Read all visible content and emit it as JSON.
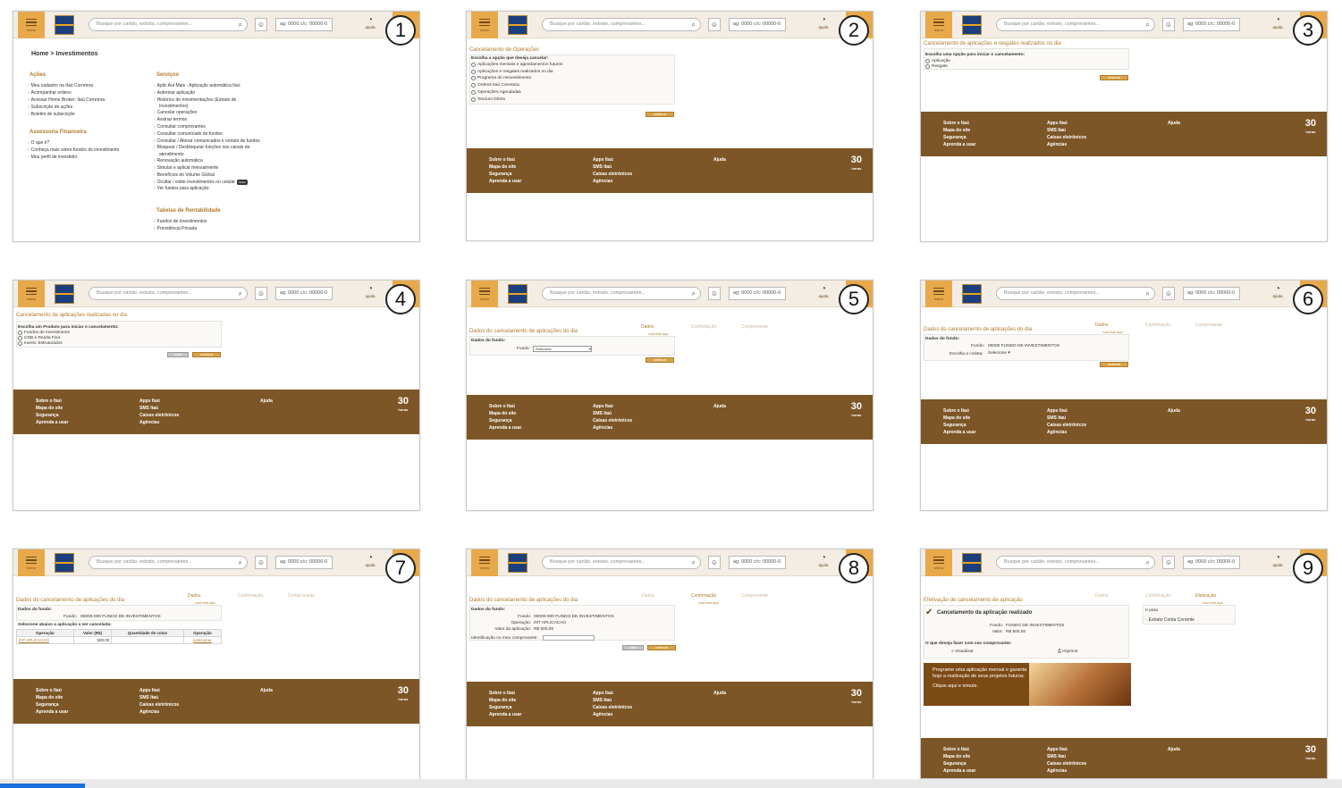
{
  "header": {
    "menu_label": "menu",
    "search_placeholder": "Busque por cartão, extrato, comprovantes...",
    "account": "ag: 0000 c/c: 00000-0",
    "help_label": "ajuda"
  },
  "footer": {
    "col1": [
      "Sobre o Itaú",
      "Mapa do site",
      "Segurança",
      "Aprenda a usar"
    ],
    "col2": [
      "Apps Itaú",
      "SMS Itaú",
      "Caixas eletrônicos",
      "Agências"
    ],
    "col3": [
      "Ajuda"
    ],
    "badge_num": "30",
    "badge_sub": "horas"
  },
  "panels": {
    "p1": {
      "number": "1",
      "breadcrumb": "Home > Investimentos",
      "acoes_title": "Ações",
      "acoes": [
        "Meu cadastro na Itaú Corretora",
        "Acompanhar ordens",
        "Acessar Home Broker: Itaú Corretora",
        "Subscrição de ações",
        "Boletim de subscrição"
      ],
      "assessoria_title": "Assessoria Financeira",
      "assessoria": [
        "O que é?",
        "Conheça mais sobre fundos de investimento",
        "Meu perfil de investidor"
      ],
      "servicos_title": "Serviços",
      "servicos": [
        "Aplic Aut Mais - Aplicação automática Itaú",
        "Autorizar aplicação",
        "Histórico de movimentações (Extrato de",
        "Investimentos)",
        "Cancelar operações",
        "Assinar termos",
        "Consultar comprovantes",
        "Consultar comunicado de fundos",
        "Consultar / Alterar comunicados e extrato de fundos",
        "Bloquear / Desbloquear funções nos canais de",
        "atendimento",
        "Renovação automática",
        "Simular e aplicar mensalmente",
        "Benefícios do Volume Global",
        "Ocultar / exibir investimentos no celular",
        "Ver fundos para aplicação"
      ],
      "novo_badge": "novo",
      "tabelas_title": "Tabelas de Rentabilidade",
      "tabelas": [
        "Fundos de Investimentos",
        "Previdência Privada"
      ]
    },
    "p2": {
      "number": "2",
      "title": "Cancelamento de Operações",
      "prompt": "Escolha a opção que deseja cancelar:",
      "options": [
        "Aplicações mensais e agendamentos futuros",
        "Aplicações e resgates realizados no dia",
        "Programa de reinvestimento",
        "Ordens Itaú Corretora",
        "Operações Agendadas",
        "Tesouro Direto"
      ],
      "continue": "continuar"
    },
    "p3": {
      "number": "3",
      "title": "Cancelamento de aplicações e resgates realizados no dia",
      "prompt": "Escolha uma opção para iniciar o cancelamento:",
      "options": [
        "Aplicação",
        "Resgate"
      ],
      "continue": "continuar"
    },
    "p4": {
      "number": "4",
      "title": "Cancelamento de aplicações realizadas no dia",
      "prompt": "Escolha um Produto para iniciar o cancelamento:",
      "options": [
        "Fundos de Investimento",
        "CDB e Renda Fixa",
        "Invest. Estruturados"
      ],
      "back": "voltar",
      "continue": "continuar"
    },
    "p5": {
      "number": "5",
      "title": "Dados do cancelamento de aplicações do dia",
      "steps": [
        "Dados",
        "Confirmação",
        "Comprovante"
      ],
      "you_are_here": "você está aqui",
      "fund_data": "Dados do fundo:",
      "fund_label": "Fundo:",
      "fund_select": "Selecione",
      "continue": "continuar"
    },
    "p6": {
      "number": "6",
      "title": "Dados do cancelamento de aplicações do dia",
      "steps": [
        "Dados",
        "Confirmação",
        "Comprovante"
      ],
      "you_are_here": "você está aqui",
      "fund_data": "Dados do fundo:",
      "fund_label": "Fundo:",
      "fund_value": "00000 FUNDO DE INVESTIMENTOS",
      "quota_label": "Escolha a cotista:",
      "quota_select": "Selecione",
      "continue": "continuar"
    },
    "p7": {
      "number": "7",
      "title": "Dados do cancelamento de aplicações do dia",
      "steps": [
        "Dados",
        "Confirmação",
        "Comprovante"
      ],
      "you_are_here": "você está aqui",
      "fund_data": "Dados do fundo:",
      "fund_label": "Fundo:",
      "fund_value": "00000-000 FUNDO DE INVESTIMENTOS",
      "select_prompt": "Selecione abaixo a aplicação a ser cancelada:",
      "table_headers": [
        "Operação",
        "Valor (R$)",
        "Quantidade de cotas",
        "Operação"
      ],
      "table_row": [
        "INT APLICACAO",
        "500,00",
        "",
        "selecionar"
      ]
    },
    "p8": {
      "number": "8",
      "title": "Dados do cancelamento de aplicações do dia",
      "steps": [
        "Dados",
        "Confirmação",
        "Comprovante"
      ],
      "you_are_here": "você está aqui",
      "fund_data": "Dados do fundo:",
      "rows": [
        {
          "label": "Fundo:",
          "value": "00000-000 FUNDO DE INVESTIMENTOS"
        },
        {
          "label": "Operação:",
          "value": "INT APLICACAO"
        },
        {
          "label": "Valor da aplicação:",
          "value": "R$ 500,00"
        }
      ],
      "id_label": "Identificação no meu comprovante:",
      "back": "voltar",
      "continue": "continuar"
    },
    "p9": {
      "number": "9",
      "title": "Efetivação de cancelamento de aplicação",
      "steps": [
        "Dados",
        "Confirmação",
        "Efetivação"
      ],
      "you_are_here": "você está aqui",
      "success": "Cancelamento da aplicação realizado",
      "rows": [
        {
          "label": "Fundo:",
          "value": "FUNDO DE INVESTIMENTOS"
        },
        {
          "label": "Valor:",
          "value": "R$ 500,00"
        }
      ],
      "what_to_do": "O que deseja fazer com seu comprovante:",
      "view": "Visualizar",
      "print": "Imprimir",
      "goto_title": "Ir para",
      "goto_link": "Extrato Conta Corrente",
      "promo_text": "Programe uma aplicação mensal e garanta hoje a realização de seus projetos futuros.",
      "promo_link": "Clique aqui e simule."
    }
  }
}
